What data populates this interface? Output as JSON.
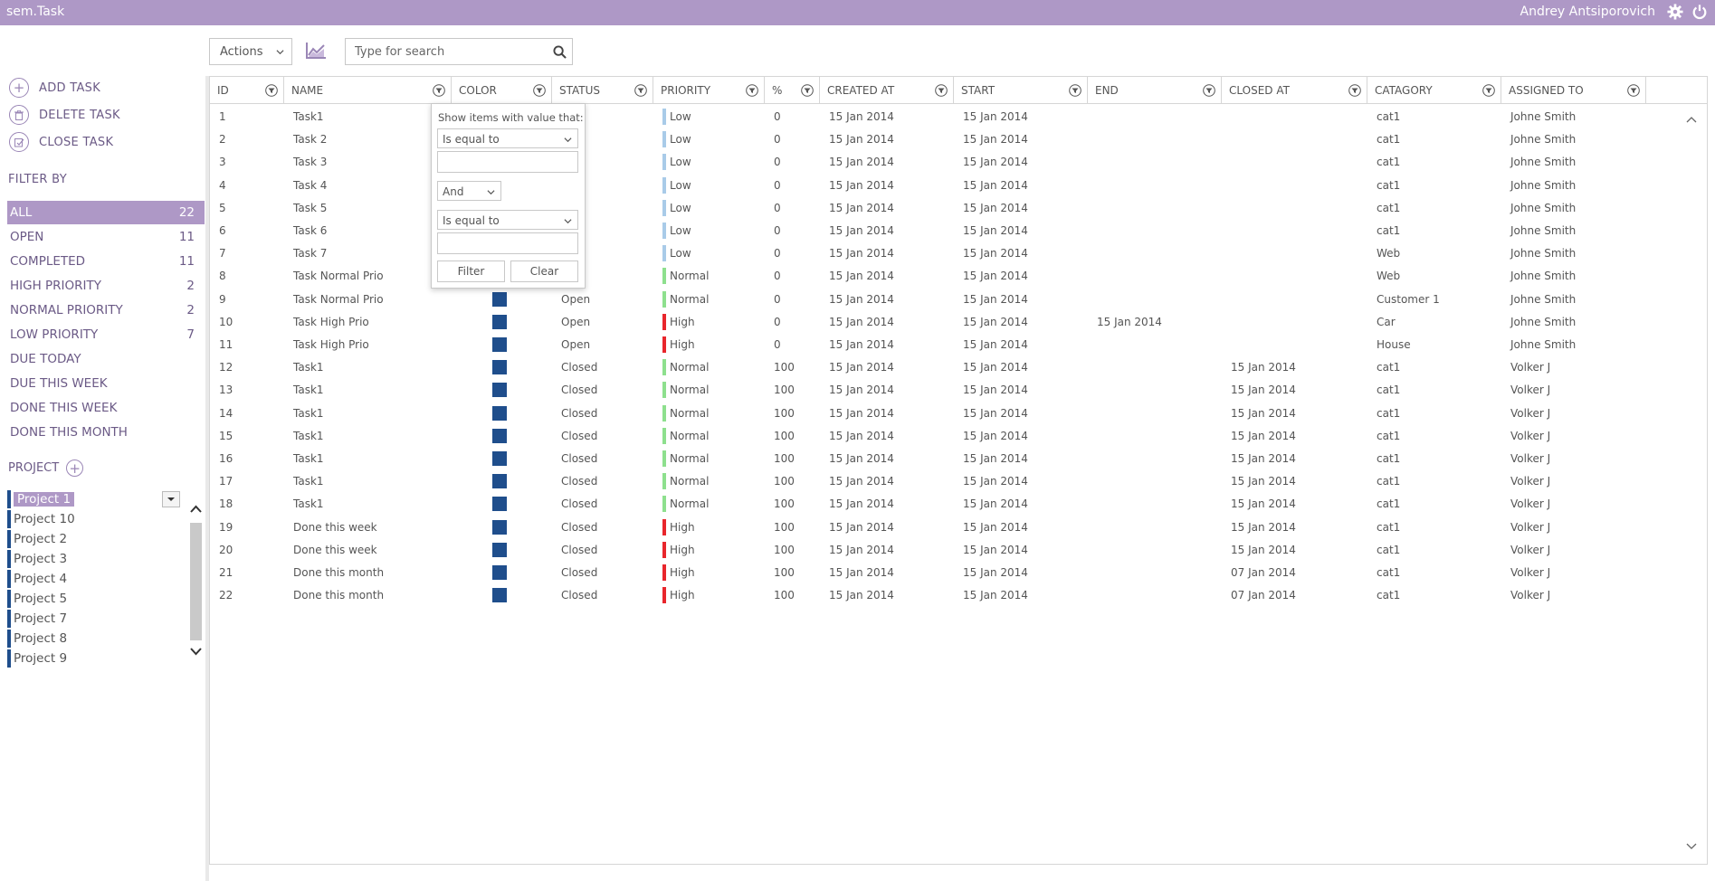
{
  "app": {
    "title": "sem.Task",
    "user": "Andrey Antsiporovich"
  },
  "toolbar": {
    "actions_label": "Actions",
    "search_placeholder": "Type for search"
  },
  "commands": [
    {
      "label": "ADD TASK",
      "icon": "plus-icon"
    },
    {
      "label": "DELETE TASK",
      "icon": "trash-icon"
    },
    {
      "label": "CLOSE TASK",
      "icon": "close-task-icon"
    }
  ],
  "filter": {
    "title": "FILTER BY",
    "items": [
      {
        "label": "ALL",
        "count": "22"
      },
      {
        "label": "OPEN",
        "count": "11"
      },
      {
        "label": "COMPLETED",
        "count": "11"
      },
      {
        "label": "HIGH PRIORITY",
        "count": "2"
      },
      {
        "label": "NORMAL PRIORITY",
        "count": "2"
      },
      {
        "label": "LOW PRIORITY",
        "count": "7"
      },
      {
        "label": "DUE TODAY",
        "count": ""
      },
      {
        "label": "DUE THIS WEEK",
        "count": ""
      },
      {
        "label": "DONE THIS WEEK",
        "count": ""
      },
      {
        "label": "DONE THIS MONTH",
        "count": ""
      }
    ]
  },
  "projects": {
    "title": "PROJECT",
    "items": [
      "Project 1",
      "Project 10",
      "Project 2",
      "Project 3",
      "Project 4",
      "Project 5",
      "Project 7",
      "Project 8",
      "Project 9"
    ]
  },
  "grid": {
    "columns": [
      "ID",
      "NAME",
      "COLOR",
      "STATUS",
      "PRIORITY",
      "%",
      "CREATED AT",
      "START",
      "END",
      "CLOSED AT",
      "CATAGORY",
      "ASSIGNED TO"
    ],
    "rows": [
      [
        "1",
        "Task1",
        "",
        "",
        "Low",
        "0",
        "15 Jan 2014",
        "15 Jan 2014",
        "",
        "",
        "cat1",
        "Johne Smith"
      ],
      [
        "2",
        "Task 2",
        "",
        "",
        "Low",
        "0",
        "15 Jan 2014",
        "15 Jan 2014",
        "",
        "",
        "cat1",
        "Johne Smith"
      ],
      [
        "3",
        "Task 3",
        "",
        "",
        "Low",
        "0",
        "15 Jan 2014",
        "15 Jan 2014",
        "",
        "",
        "cat1",
        "Johne Smith"
      ],
      [
        "4",
        "Task 4",
        "",
        "",
        "Low",
        "0",
        "15 Jan 2014",
        "15 Jan 2014",
        "",
        "",
        "cat1",
        "Johne Smith"
      ],
      [
        "5",
        "Task 5",
        "",
        "",
        "Low",
        "0",
        "15 Jan 2014",
        "15 Jan 2014",
        "",
        "",
        "cat1",
        "Johne Smith"
      ],
      [
        "6",
        "Task 6",
        "",
        "",
        "Low",
        "0",
        "15 Jan 2014",
        "15 Jan 2014",
        "",
        "",
        "cat1",
        "Johne Smith"
      ],
      [
        "7",
        "Task 7",
        "",
        "",
        "Low",
        "0",
        "15 Jan 2014",
        "15 Jan 2014",
        "",
        "",
        "Web",
        "Johne Smith"
      ],
      [
        "8",
        "Task Normal Prio",
        "",
        "",
        "Normal",
        "0",
        "15 Jan 2014",
        "15 Jan 2014",
        "",
        "",
        "Web",
        "Johne Smith"
      ],
      [
        "9",
        "Task Normal Prio",
        "",
        "Open",
        "Normal",
        "0",
        "15 Jan 2014",
        "15 Jan 2014",
        "",
        "",
        "Customer 1",
        "Johne Smith"
      ],
      [
        "10",
        "Task High Prio",
        "",
        "Open",
        "High",
        "0",
        "15 Jan 2014",
        "15 Jan 2014",
        "15 Jan 2014",
        "",
        "Car",
        "Johne Smith"
      ],
      [
        "11",
        "Task High Prio",
        "",
        "Open",
        "High",
        "0",
        "15 Jan 2014",
        "15 Jan 2014",
        "",
        "",
        "House",
        "Johne Smith"
      ],
      [
        "12",
        "Task1",
        "",
        "Closed",
        "Normal",
        "100",
        "15 Jan 2014",
        "15 Jan 2014",
        "",
        "15 Jan 2014",
        "cat1",
        "Volker J"
      ],
      [
        "13",
        "Task1",
        "",
        "Closed",
        "Normal",
        "100",
        "15 Jan 2014",
        "15 Jan 2014",
        "",
        "15 Jan 2014",
        "cat1",
        "Volker J"
      ],
      [
        "14",
        "Task1",
        "",
        "Closed",
        "Normal",
        "100",
        "15 Jan 2014",
        "15 Jan 2014",
        "",
        "15 Jan 2014",
        "cat1",
        "Volker J"
      ],
      [
        "15",
        "Task1",
        "",
        "Closed",
        "Normal",
        "100",
        "15 Jan 2014",
        "15 Jan 2014",
        "",
        "15 Jan 2014",
        "cat1",
        "Volker J"
      ],
      [
        "16",
        "Task1",
        "",
        "Closed",
        "Normal",
        "100",
        "15 Jan 2014",
        "15 Jan 2014",
        "",
        "15 Jan 2014",
        "cat1",
        "Volker J"
      ],
      [
        "17",
        "Task1",
        "",
        "Closed",
        "Normal",
        "100",
        "15 Jan 2014",
        "15 Jan 2014",
        "",
        "15 Jan 2014",
        "cat1",
        "Volker J"
      ],
      [
        "18",
        "Task1",
        "",
        "Closed",
        "Normal",
        "100",
        "15 Jan 2014",
        "15 Jan 2014",
        "",
        "15 Jan 2014",
        "cat1",
        "Volker J"
      ],
      [
        "19",
        "Done this week",
        "",
        "Closed",
        "High",
        "100",
        "15 Jan 2014",
        "15 Jan 2014",
        "",
        "15 Jan 2014",
        "cat1",
        "Volker J"
      ],
      [
        "20",
        "Done this week",
        "",
        "Closed",
        "High",
        "100",
        "15 Jan 2014",
        "15 Jan 2014",
        "",
        "15 Jan 2014",
        "cat1",
        "Volker J"
      ],
      [
        "21",
        "Done this month",
        "",
        "Closed",
        "High",
        "100",
        "15 Jan 2014",
        "15 Jan 2014",
        "",
        "07 Jan 2014",
        "cat1",
        "Volker J"
      ],
      [
        "22",
        "Done this month",
        "",
        "Closed",
        "High",
        "100",
        "15 Jan 2014",
        "15 Jan 2014",
        "",
        "07 Jan 2014",
        "cat1",
        "Volker J"
      ]
    ]
  },
  "filter_popup": {
    "title": "Show items with value that:",
    "operator1": "Is equal to",
    "logic": "And",
    "operator2": "Is equal to",
    "filter_button": "Filter",
    "clear_button": "Clear"
  },
  "colors": {
    "accent": "#ae98c6",
    "task_color": "#1f4e8c",
    "priority_low": "#a9cbe8",
    "priority_normal": "#8ee08e",
    "priority_high": "#e8262c"
  }
}
